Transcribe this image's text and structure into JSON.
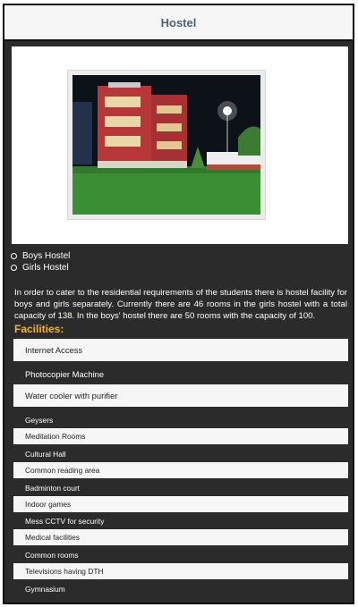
{
  "header": {
    "title": "Hostel"
  },
  "image": {
    "alt": "Hostel building at night"
  },
  "hostels": [
    "Boys Hostel",
    "Girls Hostel"
  ],
  "description": "In order to cater to the residential requirements of the students there is hostel facility for boys and girls separately. Currently there are 46 rooms in the girls hostel with a total capacity of 138. In the boys' hostel there are 50 rooms with the capacity of 100.",
  "facilities": {
    "title": "Facilities:",
    "items": [
      "Internet Access",
      "Photocopier Machine",
      "Water cooler with purifier",
      "Geysers",
      "Meditation Rooms",
      "Cultural Hall",
      "Common reading area",
      "Badminton court",
      "Indoor games",
      "Mess CCTV for security",
      "Medical facilities",
      "Common rooms",
      "Televisions having DTH",
      "Gymnasium"
    ]
  },
  "colors": {
    "accent": "#f0b42b",
    "header_text": "#4d6178",
    "panel_bg": "#2b2b2b"
  }
}
